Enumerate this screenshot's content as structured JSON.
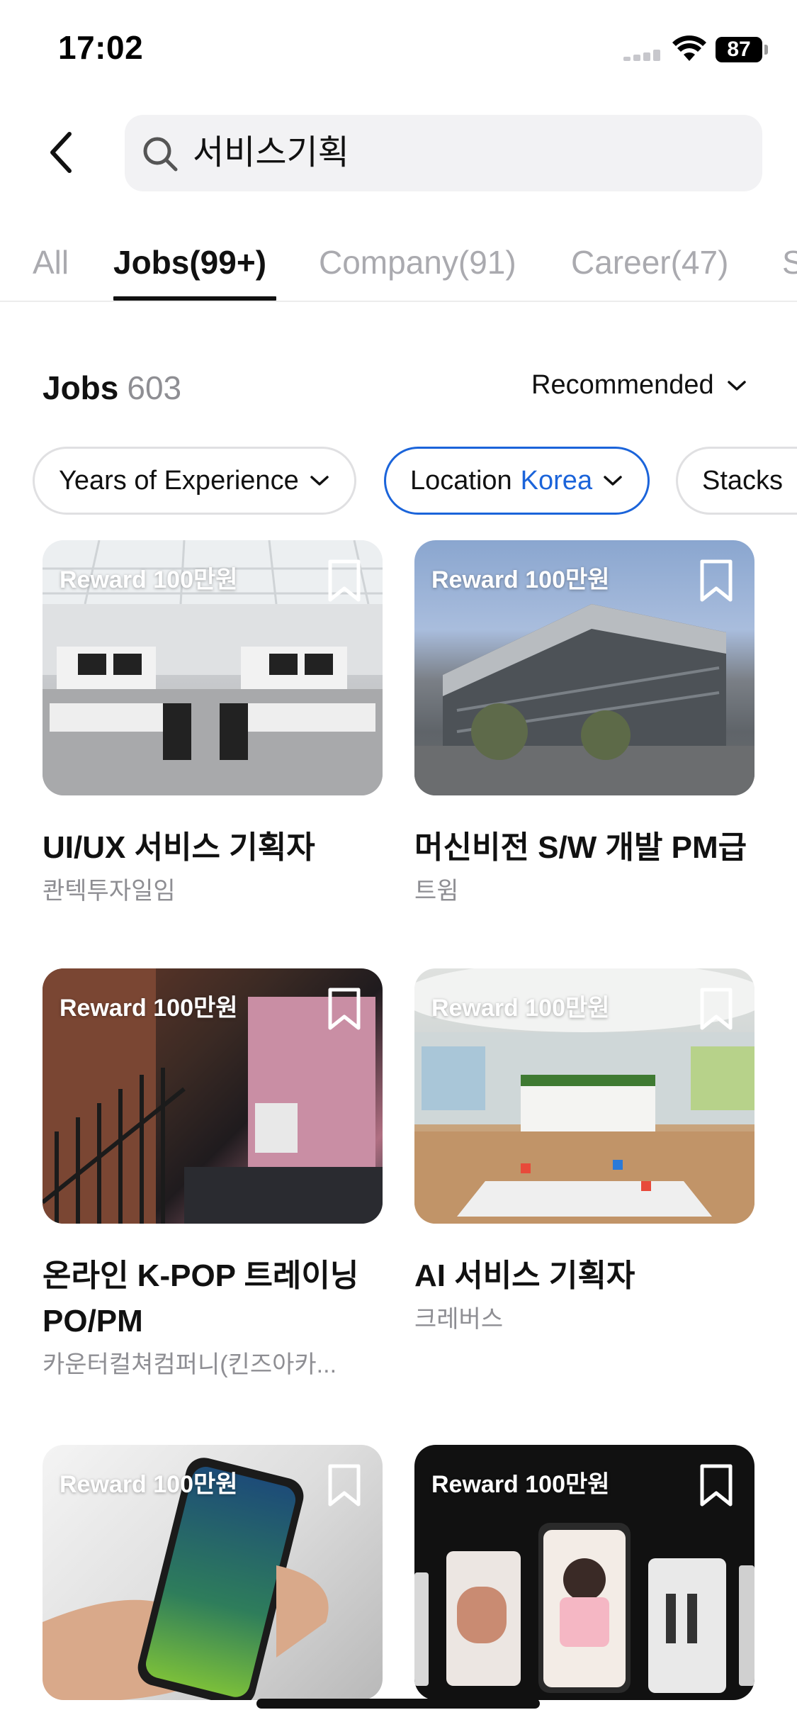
{
  "status_bar": {
    "time": "17:02",
    "battery": "87"
  },
  "search": {
    "query": "서비스기획"
  },
  "tabs": [
    {
      "label": "All"
    },
    {
      "label": "Jobs(99+)"
    },
    {
      "label": "Company(91)"
    },
    {
      "label": "Career(47)"
    },
    {
      "label": "S"
    }
  ],
  "jobs_header": {
    "title": "Jobs",
    "count": "603",
    "sort_label": "Recommended"
  },
  "filters": [
    {
      "label": "Years of Experience"
    },
    {
      "label": "Location",
      "value": "Korea"
    },
    {
      "label": "Stacks"
    }
  ],
  "cards": [
    {
      "reward": "Reward 100만원",
      "title": "UI/UX 서비스 기획자",
      "company": "콴텍투자일임"
    },
    {
      "reward": "Reward 100만원",
      "title": "머신비전 S/W 개발 PM급",
      "company": "트윔"
    },
    {
      "reward": "Reward 100만원",
      "title": "온라인 K-POP 트레이닝 PO/PM",
      "company": "카운터컬쳐컴퍼니(킨즈아카..."
    },
    {
      "reward": "Reward 100만원",
      "title": "AI 서비스 기획자",
      "company": "크레버스"
    },
    {
      "reward": "Reward 100만원",
      "title": "",
      "company": ""
    },
    {
      "reward": "Reward 100만원",
      "title": "",
      "company": ""
    }
  ],
  "colors": {
    "accent": "#1b64da",
    "muted": "#8e8e93",
    "tab_inactive": "#aaaaaf"
  }
}
